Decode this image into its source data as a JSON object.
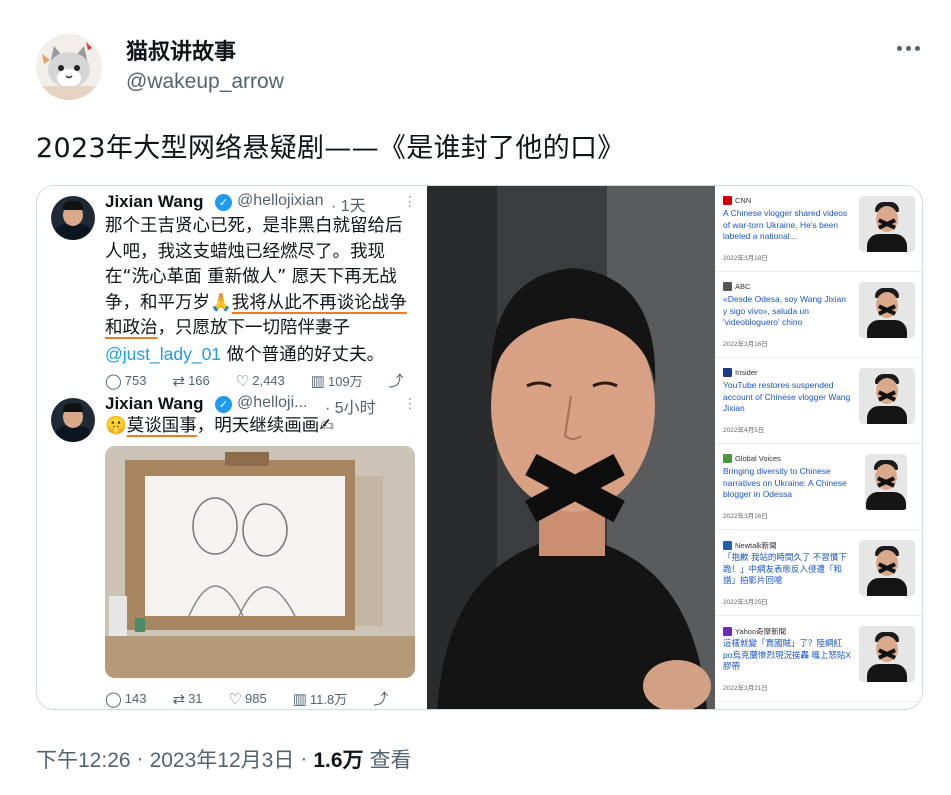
{
  "tweet": {
    "author_name": "猫叔讲故事",
    "author_handle": "@wakeup_arrow",
    "text": "2023年大型网络悬疑剧——《是谁封了他的口》",
    "time": "下午12:26",
    "date": "2023年12月3日",
    "views_count": "1.6万",
    "views_label": "查看",
    "separator": "·"
  },
  "embedded_posts": [
    {
      "name": "Jixian Wang",
      "handle": "@hellojixian",
      "time": "· 1天",
      "body_part1": "那个王吉贤心已死，是非黑白就留给后人吧，我这支蜡烛已经燃尽了。我现在“洗心革面 重新做人” 愿天下再无战争，和平万岁🙏",
      "body_highlight": "我将从此不再谈论战争和政治",
      "body_part2": "，只愿放下一切陪伴妻子",
      "mention": "@just_lady_01",
      "body_part3": "做个普通的好丈夫。",
      "replies": "753",
      "retweets": "166",
      "likes": "2,443",
      "views": "109万"
    },
    {
      "name": "Jixian Wang",
      "handle": "@helloji...",
      "time": "· 5小时",
      "body_emoji": "🤫",
      "body_highlight": "莫谈国事",
      "body_rest": "，明天继续画画✍",
      "replies": "143",
      "retweets": "31",
      "likes": "985",
      "views": "11.8万"
    }
  ],
  "news": [
    {
      "source": "CNN",
      "color": "#cc0000",
      "title": "A Chinese vlogger shared videos of war-torn Ukraine. He's been labeled a national...",
      "date": "2022年3月18日"
    },
    {
      "source": "ABC",
      "color": "#555555",
      "title": "«Desde Odesa, soy Wang Jixian y sigo vivo», saluda un 'videobloguero' chino",
      "date": "2022年3月16日"
    },
    {
      "source": "Insider",
      "color": "#1a3b8c",
      "title": "YouTube restores suspended account of Chinese vlogger Wang Jixian",
      "date": "2022年4月5日"
    },
    {
      "source": "Global Voices",
      "color": "#4a9a3a",
      "title": "Bringing diversity to Chinese narratives on Ukraine: A Chinese blogger in Odessa",
      "date": "2022年3月16日"
    },
    {
      "source": "Newtalk新聞",
      "color": "#1e5fa8",
      "title": "「抱歉 我站的時間久了 不習慣下跪！」中網友表態反入侵遭「和諧」拍影片回嗆",
      "date": "2022年3月25日"
    },
    {
      "source": "Yahoo奇摩新聞",
      "color": "#6b2bb8",
      "title": "這樣就變「賣國賊」了？陸網紅po烏克蘭慘烈現況挨轟 嘴上怒貼X膠帶",
      "date": "2022年3月21日"
    }
  ]
}
